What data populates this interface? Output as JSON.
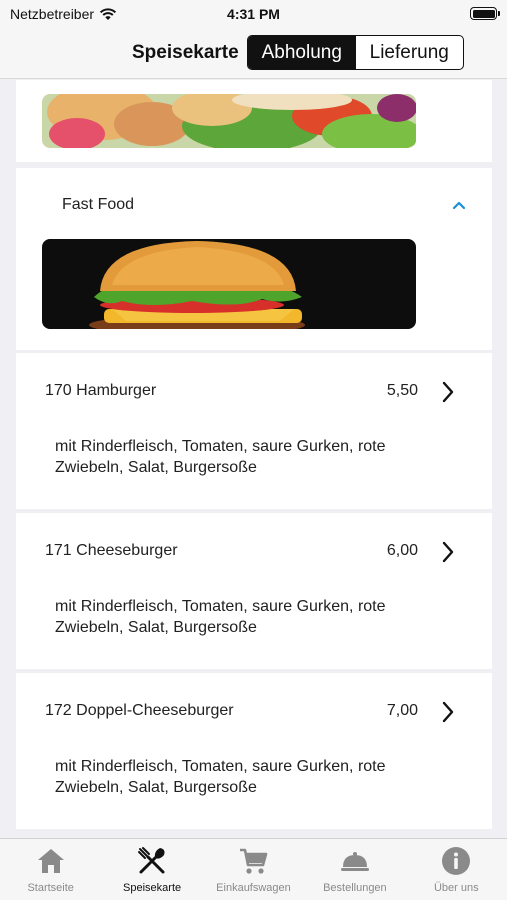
{
  "status": {
    "carrier": "Netzbetreiber",
    "time": "4:31 PM"
  },
  "header": {
    "title": "Speisekarte",
    "segments": [
      {
        "label": "Abholung",
        "active": true
      },
      {
        "label": "Lieferung",
        "active": false
      }
    ]
  },
  "category": {
    "title": "Fast Food",
    "expanded": true
  },
  "items": [
    {
      "name": "170 Hamburger",
      "price": "5,50",
      "description": "mit Rinderfleisch, Tomaten, saure Gurken, rote Zwiebeln, Salat, Burgersoße"
    },
    {
      "name": "171 Cheeseburger",
      "price": "6,00",
      "description": "mit Rinderfleisch, Tomaten, saure Gurken, rote Zwiebeln, Salat, Burgersoße"
    },
    {
      "name": "172 Doppel-Cheeseburger",
      "price": "7,00",
      "description": "mit Rinderfleisch, Tomaten, saure Gurken, rote Zwiebeln, Salat, Burgersoße"
    }
  ],
  "tabs": [
    {
      "label": "Startseite",
      "icon": "home-icon",
      "active": false
    },
    {
      "label": "Speisekarte",
      "icon": "fork-knife-icon",
      "active": true
    },
    {
      "label": "Einkaufswagen",
      "icon": "cart-icon",
      "active": false
    },
    {
      "label": "Bestellungen",
      "icon": "cloche-icon",
      "active": false
    },
    {
      "label": "Über uns",
      "icon": "info-icon",
      "active": false
    }
  ],
  "colors": {
    "accent": "#1a8fd8",
    "active_tab": "#111111",
    "inactive_tab": "#8a8a8a"
  }
}
